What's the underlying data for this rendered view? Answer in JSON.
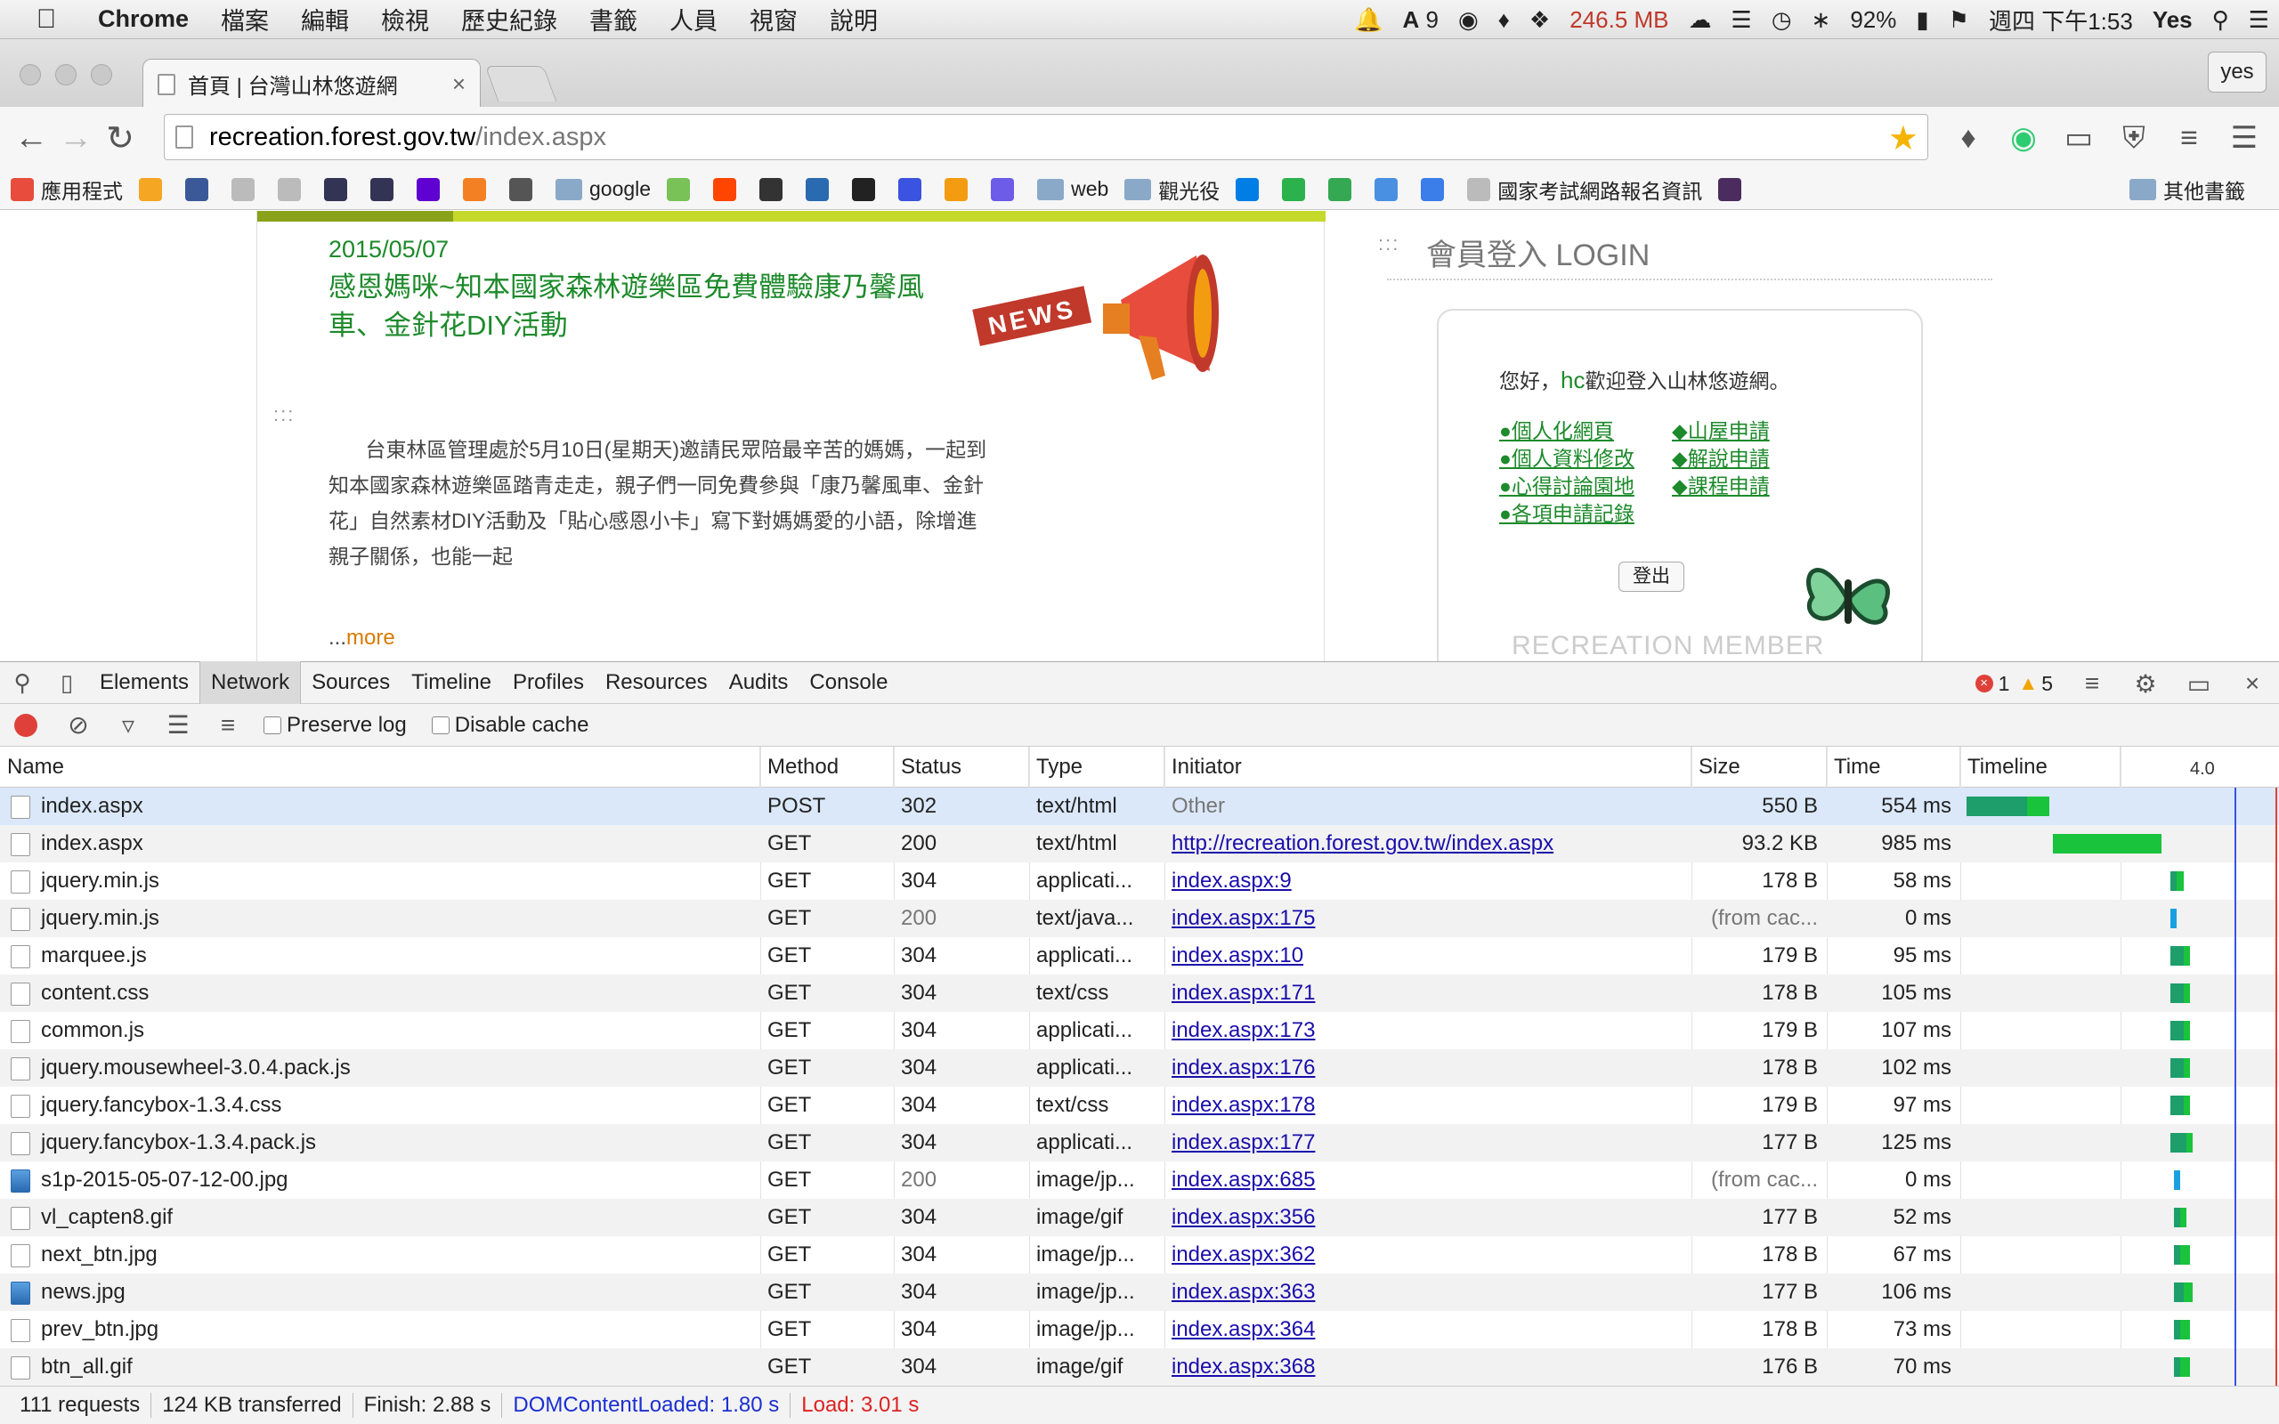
{
  "menubar": {
    "app": "Chrome",
    "menus": [
      "檔案",
      "編輯",
      "檢視",
      "歷史紀錄",
      "書籤",
      "人員",
      "視窗",
      "說明"
    ],
    "status": {
      "adobe_count": "9",
      "memory": "246.5 MB",
      "battery": "92%",
      "datetime": "週四 下午1:53",
      "user": "Yes"
    }
  },
  "chrome": {
    "tab_title": "首頁 | 台灣山林悠遊網",
    "profile_label": "yes",
    "url_domain": "recreation.forest.gov.tw",
    "url_path": "/index.aspx",
    "bookmarks": [
      {
        "label": "應用程式",
        "icon": "apps-grid-icon",
        "color": "#e74c3c"
      },
      {
        "label": "",
        "icon": "box-icon",
        "color": "#f5a623"
      },
      {
        "label": "",
        "icon": "facebook-icon",
        "color": "#3b5998"
      },
      {
        "label": "",
        "icon": "page-icon",
        "color": "#bbbbbb"
      },
      {
        "label": "",
        "icon": "page-icon",
        "color": "#bbbbbb"
      },
      {
        "label": "",
        "icon": "photo-icon",
        "color": "#333355"
      },
      {
        "label": "",
        "icon": "photo-icon",
        "color": "#333355"
      },
      {
        "label": "",
        "icon": "yahoo-icon",
        "color": "#5f01d1"
      },
      {
        "label": "",
        "icon": "stack-icon",
        "color": "#f48024"
      },
      {
        "label": "",
        "icon": "panda-icon",
        "color": "#555555"
      },
      {
        "label": "google",
        "icon": "folder-icon",
        "color": "#8aa9c9"
      },
      {
        "label": "",
        "icon": "android-icon",
        "color": "#78c257"
      },
      {
        "label": "",
        "icon": "reddit-icon",
        "color": "#ff4500"
      },
      {
        "label": "",
        "icon": "bomb-icon",
        "color": "#333333"
      },
      {
        "label": "",
        "icon": "wave-icon",
        "color": "#2a6ab0"
      },
      {
        "label": "",
        "icon": "github-icon",
        "color": "#222222"
      },
      {
        "label": "",
        "icon": "ytmp3-icon",
        "color": "#3a53e0"
      },
      {
        "label": "",
        "icon": "arrow-icon",
        "color": "#f39c12"
      },
      {
        "label": "",
        "icon": "az-icon",
        "color": "#6c5ce7"
      },
      {
        "label": "web",
        "icon": "folder-icon",
        "color": "#8aa9c9"
      },
      {
        "label": "觀光役",
        "icon": "folder-icon",
        "color": "#8aa9c9"
      },
      {
        "label": "",
        "icon": "dropbox-icon",
        "color": "#007ee5"
      },
      {
        "label": "",
        "icon": "feedly-icon",
        "color": "#2bb24c"
      },
      {
        "label": "",
        "icon": "play-store-icon",
        "color": "#34a853"
      },
      {
        "label": "",
        "icon": "p-icon",
        "color": "#4a90e2"
      },
      {
        "label": "",
        "icon": "eight-icon",
        "color": "#3b7de9"
      },
      {
        "label": "國家考試網路報名資訊",
        "icon": "page-icon",
        "color": "#bbbbbb"
      },
      {
        "label": "",
        "icon": "d-icon",
        "color": "#4b2c5e"
      }
    ],
    "bookmarks_more": "»",
    "other_bookmarks": "其他書籤"
  },
  "page": {
    "news_date": "2015/05/07",
    "news_title": "感恩媽咪~知本國家森林遊樂區免費體驗康乃馨風車、金針花DIY活動",
    "news_badge": "NEWS",
    "dots": ":::",
    "news_body": "台東林區管理處於5月10日(星期天)邀請民眾陪最辛苦的媽媽，一起到知本國家森林遊樂區踏青走走，親子們一同免費參與「康乃馨風車、金針花」自然素材DIY活動及「貼心感恩小卡」寫下對媽媽愛的小語，除增進親子關係，也能一起",
    "more_prefix": "...",
    "more_link": "more",
    "login_heading": "會員登入 LOGIN",
    "welcome_prefix": "您好，",
    "welcome_user": "hc",
    "welcome_suffix": "歡迎登入山林悠遊網。",
    "links_left": [
      "●個人化網頁",
      "●個人資料修改",
      "●心得討論園地",
      "●各項申請記錄"
    ],
    "links_right": [
      "◆山屋申請",
      "◆解說申請",
      "◆課程申請"
    ],
    "logout": "登出",
    "member_label": "RECREATION MEMBER"
  },
  "devtools": {
    "panels": [
      "Elements",
      "Network",
      "Sources",
      "Timeline",
      "Profiles",
      "Resources",
      "Audits",
      "Console"
    ],
    "active_panel": "Network",
    "error_count": "1",
    "warning_count": "5",
    "preserve_log": "Preserve log",
    "disable_cache": "Disable cache",
    "columns": [
      "Name",
      "Method",
      "Status",
      "Type",
      "Initiator",
      "Size",
      "Time",
      "Timeline"
    ],
    "timeline_scale": "4.0",
    "rows": [
      {
        "name": "index.aspx",
        "method": "POST",
        "status": "302",
        "type": "text/html",
        "initiator": "Other",
        "initiator_link": false,
        "size": "550 B",
        "time": "554 ms",
        "cached": false,
        "icon": "doc",
        "bar_start": 0.02,
        "bar_wait": 0.19,
        "bar_recv": 0.07
      },
      {
        "name": "index.aspx",
        "method": "GET",
        "status": "200",
        "type": "text/html",
        "initiator": "http://recreation.forest.gov.tw/index.aspx",
        "initiator_link": true,
        "size": "93.2 KB",
        "time": "985 ms",
        "cached": false,
        "icon": "doc",
        "bar_start": 0.29,
        "bar_wait": 0.0,
        "bar_recv": 0.34
      },
      {
        "name": "jquery.min.js",
        "method": "GET",
        "status": "304",
        "type": "applicati...",
        "initiator": "index.aspx:9",
        "initiator_link": true,
        "size": "178 B",
        "time": "58 ms",
        "cached": false,
        "icon": "doc",
        "bar_start": 0.66,
        "bar_wait": 0.02,
        "bar_recv": 0.02
      },
      {
        "name": "jquery.min.js",
        "method": "GET",
        "status": "200",
        "type": "text/java...",
        "initiator": "index.aspx:175",
        "initiator_link": true,
        "size": "(from cac...",
        "time": "0 ms",
        "cached": true,
        "icon": "doc",
        "bar_start": 0.66,
        "bar_wait": 0.0,
        "bar_recv": 0.02
      },
      {
        "name": "marquee.js",
        "method": "GET",
        "status": "304",
        "type": "applicati...",
        "initiator": "index.aspx:10",
        "initiator_link": true,
        "size": "179 B",
        "time": "95 ms",
        "cached": false,
        "icon": "doc",
        "bar_start": 0.66,
        "bar_wait": 0.04,
        "bar_recv": 0.02
      },
      {
        "name": "content.css",
        "method": "GET",
        "status": "304",
        "type": "text/css",
        "initiator": "index.aspx:171",
        "initiator_link": true,
        "size": "178 B",
        "time": "105 ms",
        "cached": false,
        "icon": "doc",
        "bar_start": 0.66,
        "bar_wait": 0.04,
        "bar_recv": 0.02
      },
      {
        "name": "common.js",
        "method": "GET",
        "status": "304",
        "type": "applicati...",
        "initiator": "index.aspx:173",
        "initiator_link": true,
        "size": "179 B",
        "time": "107 ms",
        "cached": false,
        "icon": "doc",
        "bar_start": 0.66,
        "bar_wait": 0.04,
        "bar_recv": 0.02
      },
      {
        "name": "jquery.mousewheel-3.0.4.pack.js",
        "method": "GET",
        "status": "304",
        "type": "applicati...",
        "initiator": "index.aspx:176",
        "initiator_link": true,
        "size": "178 B",
        "time": "102 ms",
        "cached": false,
        "icon": "doc",
        "bar_start": 0.66,
        "bar_wait": 0.04,
        "bar_recv": 0.02
      },
      {
        "name": "jquery.fancybox-1.3.4.css",
        "method": "GET",
        "status": "304",
        "type": "text/css",
        "initiator": "index.aspx:178",
        "initiator_link": true,
        "size": "179 B",
        "time": "97 ms",
        "cached": false,
        "icon": "doc",
        "bar_start": 0.66,
        "bar_wait": 0.04,
        "bar_recv": 0.02
      },
      {
        "name": "jquery.fancybox-1.3.4.pack.js",
        "method": "GET",
        "status": "304",
        "type": "applicati...",
        "initiator": "index.aspx:177",
        "initiator_link": true,
        "size": "177 B",
        "time": "125 ms",
        "cached": false,
        "icon": "doc",
        "bar_start": 0.66,
        "bar_wait": 0.05,
        "bar_recv": 0.02
      },
      {
        "name": "s1p-2015-05-07-12-00.jpg",
        "method": "GET",
        "status": "200",
        "type": "image/jp...",
        "initiator": "index.aspx:685",
        "initiator_link": true,
        "size": "(from cac...",
        "time": "0 ms",
        "cached": true,
        "icon": "img",
        "bar_start": 0.67,
        "bar_wait": 0.0,
        "bar_recv": 0.02
      },
      {
        "name": "vl_capten8.gif",
        "method": "GET",
        "status": "304",
        "type": "image/gif",
        "initiator": "index.aspx:356",
        "initiator_link": true,
        "size": "177 B",
        "time": "52 ms",
        "cached": false,
        "icon": "doc",
        "bar_start": 0.67,
        "bar_wait": 0.02,
        "bar_recv": 0.02
      },
      {
        "name": "next_btn.jpg",
        "method": "GET",
        "status": "304",
        "type": "image/jp...",
        "initiator": "index.aspx:362",
        "initiator_link": true,
        "size": "178 B",
        "time": "67 ms",
        "cached": false,
        "icon": "doc",
        "bar_start": 0.67,
        "bar_wait": 0.02,
        "bar_recv": 0.03
      },
      {
        "name": "news.jpg",
        "method": "GET",
        "status": "304",
        "type": "image/jp...",
        "initiator": "index.aspx:363",
        "initiator_link": true,
        "size": "177 B",
        "time": "106 ms",
        "cached": false,
        "icon": "img",
        "bar_start": 0.67,
        "bar_wait": 0.03,
        "bar_recv": 0.03
      },
      {
        "name": "prev_btn.jpg",
        "method": "GET",
        "status": "304",
        "type": "image/jp...",
        "initiator": "index.aspx:364",
        "initiator_link": true,
        "size": "178 B",
        "time": "73 ms",
        "cached": false,
        "icon": "doc",
        "bar_start": 0.67,
        "bar_wait": 0.02,
        "bar_recv": 0.03
      },
      {
        "name": "btn_all.gif",
        "method": "GET",
        "status": "304",
        "type": "image/gif",
        "initiator": "index.aspx:368",
        "initiator_link": true,
        "size": "176 B",
        "time": "70 ms",
        "cached": false,
        "icon": "doc",
        "bar_start": 0.67,
        "bar_wait": 0.02,
        "bar_recv": 0.03
      }
    ],
    "summary": {
      "requests": "111 requests",
      "transferred": "124 KB transferred",
      "finish": "Finish: 2.88 s",
      "dcl": "DOMContentLoaded: 1.80 s",
      "load": "Load: 3.01 s"
    },
    "colors": {
      "dcl_line": "#3a53e0",
      "load_line": "#e0403a",
      "bar_wait": "#1d9e6a",
      "bar_recv": "#19c33c"
    },
    "dcl_position": 0.86,
    "load_position": 0.99
  }
}
